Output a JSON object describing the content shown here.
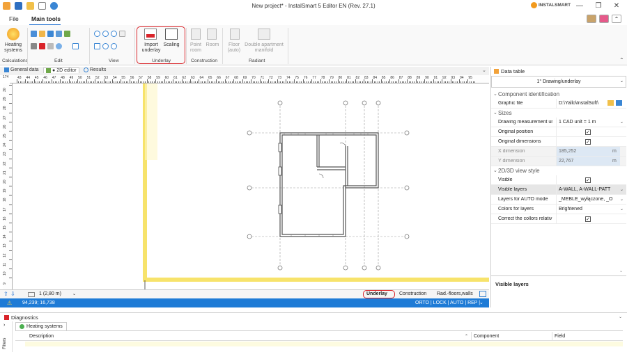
{
  "window": {
    "title": "New project* - InstalSmart 5 Editor EN (Rev. 27.1)",
    "brand": "INSTALSMART",
    "minimize": "—",
    "restore": "❐",
    "close": "✕"
  },
  "menu": {
    "file": "File",
    "main_tools": "Main tools"
  },
  "ribbon": {
    "heating_systems_label": "Heating systems",
    "import_underlay_label": "Import underlay",
    "scaling_label": "Scaling",
    "point_room_label": "Point room",
    "room_label": "Room",
    "floor_auto_label": "Floor (auto)",
    "double_manifold_label": "Double apartment manifold",
    "groups": {
      "calculations": "Calculations",
      "edit": "Edit",
      "view": "View",
      "underlay": "Underlay",
      "construction": "Construction",
      "radiant": "Radiant"
    }
  },
  "doc_tabs": {
    "general_data": "General data",
    "editor_2d": "2D editor",
    "results": "Results"
  },
  "ruler": {
    "corner": "174",
    "h_numbers": [
      "43",
      "44",
      "45",
      "46",
      "47",
      "48",
      "49",
      "50",
      "51",
      "52",
      "53",
      "54",
      "55",
      "56",
      "57",
      "58",
      "59",
      "60",
      "61",
      "62",
      "63",
      "64",
      "65",
      "66",
      "67",
      "68",
      "69",
      "70",
      "71",
      "72",
      "73",
      "74",
      "75",
      "76",
      "77",
      "78",
      "79",
      "80",
      "81",
      "82",
      "83",
      "84",
      "85",
      "86",
      "87",
      "88",
      "89",
      "90",
      "91",
      "92",
      "93",
      "94",
      "95"
    ],
    "v_numbers": [
      "30",
      "29",
      "28",
      "27",
      "26",
      "25",
      "24",
      "23",
      "22",
      "21",
      "20",
      "19",
      "18",
      "17",
      "16",
      "15",
      "14",
      "13",
      "12",
      "11",
      "10",
      "9"
    ]
  },
  "canvas_bar": {
    "floor": "1 (2,80 m)",
    "layer_underlay": "Underlay",
    "layer_construction": "Construction",
    "layer_rad": "Rad.-floors,walls"
  },
  "status": {
    "coords": "94,239; 16,738",
    "modes": "ORTO | LOCK | AUTO | REP |"
  },
  "panel": {
    "title": "Data table",
    "selector": "1° Drawing/underlay",
    "sections": {
      "component": "Component identification",
      "sizes": "Sizes",
      "view": "2D/3D view style"
    },
    "rows": {
      "graphic_file": {
        "label": "Graphic file",
        "value": "D:\\Yallo\\InstalSoft\\"
      },
      "measurement_unit": {
        "label": "Drawing measurement un",
        "value": "1 CAD unit = 1 m"
      },
      "original_position": {
        "label": "Original position",
        "value": "✓"
      },
      "original_dimensions": {
        "label": "Original dimensions",
        "value": "✓"
      },
      "x_dimension": {
        "label": "X dimension",
        "value": "185,252",
        "unit": "m"
      },
      "y_dimension": {
        "label": "Y dimension",
        "value": "22,767",
        "unit": "m"
      },
      "visible": {
        "label": "Visible",
        "value": "✓"
      },
      "visible_layers": {
        "label": "Visible layers",
        "value": "A-WALL, A-WALL-PATT"
      },
      "layers_auto": {
        "label": "Layers for AUTO mode",
        "value": "_MEBLE_wyłączone, _O"
      },
      "colors_layers": {
        "label": "Colors for layers",
        "value": "Brightened"
      },
      "correct_colors": {
        "label": "Correct the collors relativ",
        "value": "✓"
      }
    },
    "description_title": "Visible layers"
  },
  "diagnostics": {
    "title": "Diagnostics",
    "tab": "Heating systems",
    "filters": "Filters",
    "col_description": "Description",
    "col_component": "Component",
    "col_field": "Field"
  }
}
